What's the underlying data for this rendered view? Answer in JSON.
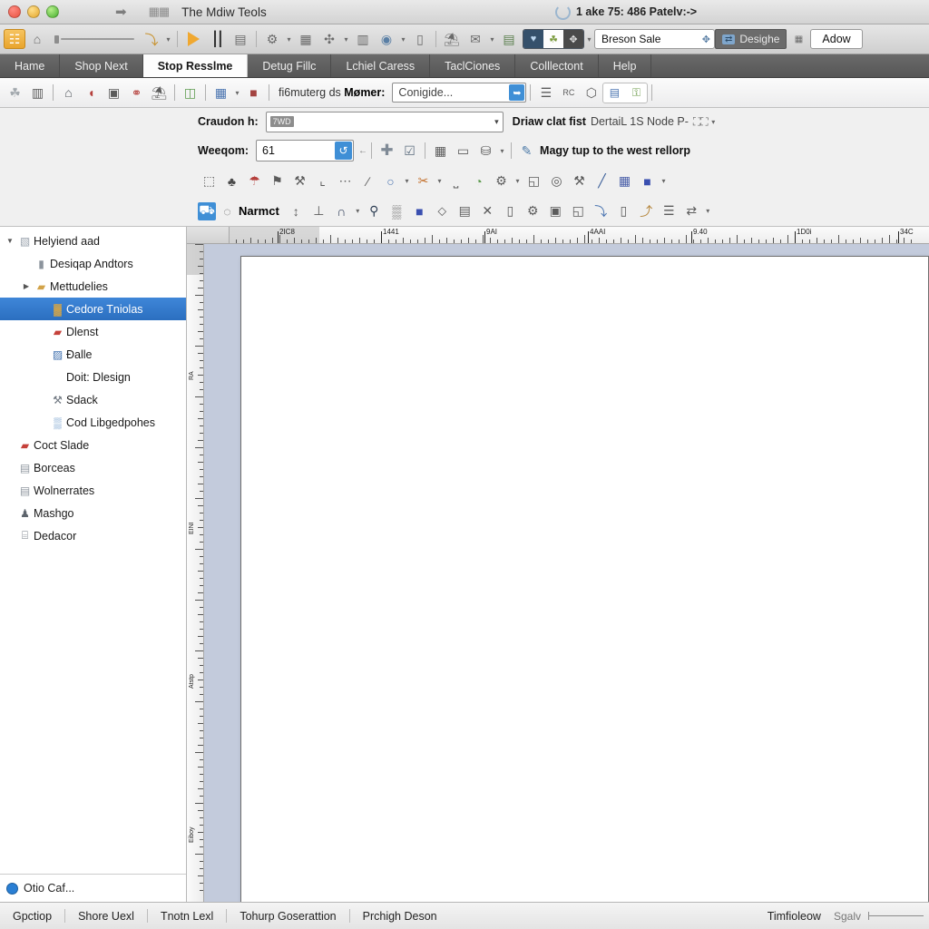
{
  "titlebar": {
    "window_title": "The Mdiw Teols",
    "arrow_icon": "arrow-right-icon",
    "doc_icon": "document-icon",
    "right_status": "1 ake 75: 486 Patelv:->",
    "spinner_icon": "loading-spinner-icon"
  },
  "main_toolbar": {
    "items": [
      {
        "name": "app-badge-button",
        "glyph": "⌗",
        "kind": "sel"
      },
      {
        "name": "home-panel-button",
        "glyph": "⌂",
        "kind": "btn"
      },
      {
        "name": "slider-control",
        "kind": "slider"
      },
      {
        "name": "undo-curve-button",
        "glyph": "⤵",
        "kind": "btn"
      },
      {
        "name": "undo-dropdown-caret",
        "glyph": "▾",
        "kind": "caret"
      },
      {
        "name": "run-play-button",
        "kind": "play"
      },
      {
        "name": "waveform-button",
        "glyph": "⦀",
        "kind": "wave"
      },
      {
        "name": "table-view-button",
        "glyph": "▤",
        "kind": "btn"
      },
      {
        "name": "settings-gear-button",
        "glyph": "⚙",
        "kind": "btn"
      },
      {
        "name": "settings-dropdown-caret",
        "glyph": "▾",
        "kind": "caret"
      },
      {
        "name": "grid-layout-button",
        "glyph": "▦",
        "kind": "btn"
      },
      {
        "name": "scatter-tool-button",
        "glyph": "⚙",
        "kind": "btn"
      },
      {
        "name": "scatter-dropdown-caret",
        "glyph": "▾",
        "kind": "caret"
      },
      {
        "name": "columns-button",
        "glyph": "▥",
        "kind": "btn"
      },
      {
        "name": "globe-button",
        "glyph": "◉",
        "kind": "btn"
      },
      {
        "name": "globe-dropdown-caret",
        "glyph": "▾",
        "kind": "caret"
      },
      {
        "name": "panel-button",
        "glyph": "▯",
        "kind": "btn"
      },
      {
        "name": "note-button",
        "glyph": "◱",
        "kind": "btn"
      },
      {
        "name": "comment-button",
        "glyph": "⬚",
        "kind": "btn"
      },
      {
        "name": "comment-dropdown-caret",
        "glyph": "▾",
        "kind": "caret"
      },
      {
        "name": "layout-preview-button",
        "glyph": "▤",
        "kind": "btn"
      }
    ],
    "mode_group": [
      {
        "name": "mode-heart-button",
        "glyph": "♥"
      },
      {
        "name": "mode-tree-button",
        "glyph": "☘"
      },
      {
        "name": "mode-move-button",
        "glyph": "✥"
      }
    ],
    "mode_caret": "▾",
    "profile_combo": {
      "value": "Breson Sale",
      "stepper_icon": "stepper-updown-icon"
    },
    "designer_pill": {
      "badge": "⇄",
      "label": "Desighe"
    },
    "extra_icon": "grid-small-icon",
    "right_button": "Adow"
  },
  "menubar": {
    "tabs": [
      {
        "label": "Hame",
        "active": false
      },
      {
        "label": "Shop Next",
        "active": false
      },
      {
        "label": "Stop Resslme",
        "active": true
      },
      {
        "label": "Detug Fillc",
        "active": false
      },
      {
        "label": "Lchiel Caress",
        "active": false
      },
      {
        "label": "TaclCiones",
        "active": false
      },
      {
        "label": "Colllectont",
        "active": false
      },
      {
        "label": "Help",
        "active": false
      }
    ]
  },
  "sub_toolbar": {
    "icons_left": [
      {
        "name": "tree-node-icon",
        "glyph": "☘"
      },
      {
        "name": "chart-column-icon",
        "glyph": "▥"
      },
      {
        "name": "home-icon",
        "glyph": "⌂"
      },
      {
        "name": "bookmark-red-icon",
        "glyph": "◖"
      },
      {
        "name": "camera-icon",
        "glyph": "▣"
      },
      {
        "name": "link-node-icon",
        "glyph": "⚭"
      },
      {
        "name": "window-split-icon",
        "glyph": "◱"
      },
      {
        "name": "green-book-icon",
        "glyph": "◫"
      },
      {
        "name": "database-icon",
        "glyph": "▦"
      },
      {
        "name": "database-caret-icon",
        "glyph": "▾"
      },
      {
        "name": "avatar-red-icon",
        "glyph": "■"
      }
    ],
    "label_prefix": "fi6muterg ds",
    "label_bold": "Mømer:",
    "input_value": "Conigide...",
    "go_icon": "go-arrow-icon",
    "icons_right": [
      {
        "name": "list-lines-icon",
        "glyph": "☰"
      },
      {
        "name": "rc-text-icon",
        "glyph": "RC"
      },
      {
        "name": "shape-outline-icon",
        "glyph": "⬡"
      }
    ],
    "toggle_pair": [
      {
        "name": "keyboard-toggle-icon",
        "glyph": "⌨"
      },
      {
        "name": "lock-toggle-icon",
        "glyph": "⚿"
      }
    ]
  },
  "options_row1": {
    "label": "Craudon h:",
    "combo_tag": "7WD",
    "combo_caret": "▾",
    "right_bold": "Driaw clat fist",
    "right_normal": "DertaiL 1S Node P-",
    "right_icon": "page-pair-icon",
    "right_caret": "▾"
  },
  "options_row2": {
    "label": "Weeqom:",
    "value": "61",
    "spin_icon": "refresh-icon",
    "small_caret": "←",
    "buttons": [
      {
        "name": "add-button",
        "glyph": "✚"
      },
      {
        "name": "insert-object-button",
        "glyph": "⊞"
      },
      {
        "name": "table-grid-button",
        "glyph": "▦"
      },
      {
        "name": "briefcase-button",
        "glyph": "▭"
      },
      {
        "name": "archive-button",
        "glyph": "⛁"
      },
      {
        "name": "archive-caret",
        "glyph": "▾"
      }
    ],
    "note_icon": "note-pencil-icon",
    "note_label": "Magy tup to the west rellorp"
  },
  "tool_row1": [
    {
      "name": "network-grid-icon",
      "glyph": "⬚"
    },
    {
      "name": "tree-fill-icon",
      "glyph": "♣"
    },
    {
      "name": "pin-red-icon",
      "glyph": "☂"
    },
    {
      "name": "stamp-icon",
      "glyph": "⚑"
    },
    {
      "name": "wrench-icon",
      "glyph": "⚒"
    },
    {
      "name": "corner-icon",
      "glyph": "⌞"
    },
    {
      "name": "ellipsis-icon",
      "glyph": "⋯"
    },
    {
      "name": "slash-lines-icon",
      "glyph": "∕"
    },
    {
      "name": "search-blue-icon",
      "glyph": "○"
    },
    {
      "name": "search-caret-icon",
      "glyph": "▾"
    },
    {
      "name": "scissors-orange-icon",
      "glyph": "✂"
    },
    {
      "name": "scissors-caret-icon",
      "glyph": "▾"
    },
    {
      "name": "bracket-icon",
      "glyph": "⎵"
    },
    {
      "name": "paint-bucket-icon",
      "glyph": "◔"
    },
    {
      "name": "gear-dark-icon",
      "glyph": "⚙"
    },
    {
      "name": "gear-caret-icon",
      "glyph": "▾"
    },
    {
      "name": "page-note-icon",
      "glyph": "◱"
    },
    {
      "name": "target-icon",
      "glyph": "◎"
    },
    {
      "name": "pipette-icon",
      "glyph": "⚒"
    },
    {
      "name": "brush-blue-icon",
      "glyph": "╱"
    },
    {
      "name": "calc-grid-icon",
      "glyph": "▦"
    },
    {
      "name": "blue-block-icon",
      "glyph": "■"
    },
    {
      "name": "blue-block-caret",
      "glyph": "▾"
    }
  ],
  "tool_row2": {
    "badge_icon": "blue-person-badge-icon",
    "circle_icon": "circle-arc-icon",
    "label": "Narmct",
    "items": [
      {
        "name": "vertical-align-icon",
        "glyph": "↕"
      },
      {
        "name": "text-baseline-icon",
        "glyph": "⊥"
      },
      {
        "name": "bell-icon",
        "glyph": "∩"
      },
      {
        "name": "bell-caret-icon",
        "glyph": "▾"
      },
      {
        "name": "magnifier-icon",
        "glyph": "⚲"
      },
      {
        "name": "barcode-icon",
        "glyph": "▒"
      },
      {
        "name": "blue-tag-icon",
        "glyph": "■"
      },
      {
        "name": "diamond-move-icon",
        "glyph": "⬦"
      },
      {
        "name": "window-fill-icon",
        "glyph": "▤"
      },
      {
        "name": "close-x-icon",
        "glyph": "✕"
      },
      {
        "name": "capsule-icon",
        "glyph": "▯"
      },
      {
        "name": "settings-cog-icon",
        "glyph": "⚙"
      },
      {
        "name": "image-frame-icon",
        "glyph": "▣"
      },
      {
        "name": "page-curl-icon",
        "glyph": "◱"
      },
      {
        "name": "export-icon",
        "glyph": "⤵"
      },
      {
        "name": "door-icon",
        "glyph": "▯"
      },
      {
        "name": "import-icon",
        "glyph": "⤴"
      },
      {
        "name": "align-list-icon",
        "glyph": "☰"
      },
      {
        "name": "swap-image-icon",
        "glyph": "⇄"
      },
      {
        "name": "swap-caret-icon",
        "glyph": "▾"
      }
    ]
  },
  "sidebar": {
    "items": [
      {
        "label": "Helyiend aad",
        "icon": "document-grey-icon",
        "glyph": "▧",
        "color": "#9aa3ad",
        "indent": 0,
        "twisty": "▼",
        "selected": false
      },
      {
        "label": "Desiqap Andtors",
        "icon": "folder-grey-icon",
        "glyph": "▮",
        "color": "#8c949d",
        "indent": 1,
        "twisty": "",
        "selected": false
      },
      {
        "label": "Mettudelies",
        "icon": "folder-open-icon",
        "glyph": "▰",
        "color": "#d2a349",
        "indent": 1,
        "twisty": "▶",
        "selected": false
      },
      {
        "label": "Cedore Tniolas",
        "icon": "blocks-icon",
        "glyph": "▓",
        "color": "#e2a93c",
        "indent": 2,
        "twisty": "",
        "selected": true
      },
      {
        "label": "Dlenst",
        "icon": "toolbox-red-icon",
        "glyph": "▰",
        "color": "#c5413a",
        "indent": 2,
        "twisty": "",
        "selected": false
      },
      {
        "label": "Ðalle",
        "icon": "blue-card-icon",
        "glyph": "▨",
        "color": "#3f6fae",
        "indent": 2,
        "twisty": "",
        "selected": false
      },
      {
        "label": "Doit: Dlesign",
        "icon": "",
        "glyph": "",
        "color": "#000",
        "indent": 2,
        "twisty": "",
        "selected": false
      },
      {
        "label": "Sdack",
        "icon": "wrench-grey-icon",
        "glyph": "⚒",
        "color": "#6f7780",
        "indent": 2,
        "twisty": "",
        "selected": false
      },
      {
        "label": "Cod Libgedpohes",
        "icon": "blue-layers-icon",
        "glyph": "▒",
        "color": "#5d8fc4",
        "indent": 2,
        "twisty": "",
        "selected": false
      },
      {
        "label": "Coct Slade",
        "icon": "toolbox-red-icon",
        "glyph": "▰",
        "color": "#c5413a",
        "indent": 0,
        "twisty": "",
        "selected": false
      },
      {
        "label": "Borceas",
        "icon": "window-grey-icon",
        "glyph": "▤",
        "color": "#8f979f",
        "indent": 0,
        "twisty": "",
        "selected": false
      },
      {
        "label": "Wolnerrates",
        "icon": "window-grey-icon",
        "glyph": "▤",
        "color": "#8f979f",
        "indent": 0,
        "twisty": "",
        "selected": false
      },
      {
        "label": "Mashgo",
        "icon": "person-icon",
        "glyph": "♟",
        "color": "#5d646c",
        "indent": 0,
        "twisty": "",
        "selected": false
      },
      {
        "label": "Dedacor",
        "icon": "keyboard-icon",
        "glyph": "⌸",
        "color": "#6f7780",
        "indent": 0,
        "twisty": "",
        "selected": false
      }
    ],
    "footer": {
      "label": "Otio Caf...",
      "icon": "status-blue-dot-icon"
    }
  },
  "rulers": {
    "h_labels": [
      "2IC8",
      "1441",
      "9AI",
      "4AAI",
      "9.40",
      "1D0i",
      "34C"
    ],
    "v_labels": [
      "RA",
      "EINI",
      "Atstp",
      "Eiboy"
    ],
    "unit_note": ""
  },
  "statusbar": {
    "left_items": [
      "Gpctiop",
      "Shore Uexl",
      "Tnotn Lexl",
      "Tohurp Goserattion",
      "Prchigh Deson"
    ],
    "right_label": "Timfioleow",
    "zoom_label": "Sgalv"
  }
}
